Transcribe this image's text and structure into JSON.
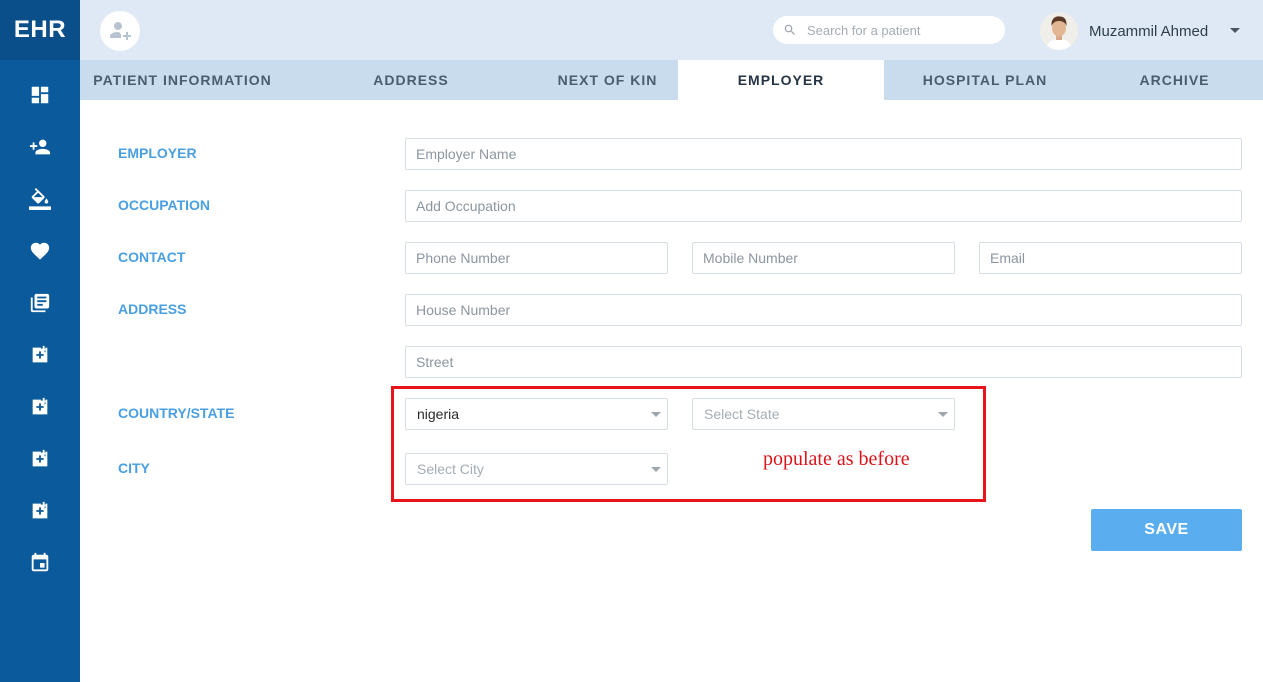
{
  "app": {
    "logo": "EHR"
  },
  "sidebar": {
    "icons": [
      "dashboard-icon",
      "add-user-icon",
      "paint-bucket-icon",
      "heart-icon",
      "library-books-icon",
      "local-hospital-icon",
      "local-hospital-icon",
      "local-hospital-icon",
      "local-hospital-icon",
      "calendar-icon"
    ]
  },
  "header": {
    "search_placeholder": "Search for a patient",
    "user_name": "Muzammil Ahmed"
  },
  "tabs": [
    {
      "label": "PATIENT INFORMATION"
    },
    {
      "label": "ADDRESS"
    },
    {
      "label": "NEXT OF KIN"
    },
    {
      "label": "EMPLOYER",
      "active": true
    },
    {
      "label": "HOSPITAL PLAN"
    },
    {
      "label": "ARCHIVE"
    }
  ],
  "form": {
    "labels": {
      "employer": "EMPLOYER",
      "occupation": "OCCUPATION",
      "contact": "CONTACT",
      "address": "ADDRESS",
      "country_state": "COUNTRY/STATE",
      "city": "CITY"
    },
    "placeholders": {
      "employer_name": "Employer Name",
      "occupation": "Add Occupation",
      "phone": "Phone Number",
      "mobile": "Mobile Number",
      "email": "Email",
      "house_number": "House Number",
      "street": "Street"
    },
    "country": {
      "value": "nigeria"
    },
    "state": {
      "placeholder": "Select State"
    },
    "city": {
      "placeholder": "Select City"
    },
    "save_label": "SAVE"
  },
  "annotation": {
    "text": "populate as before",
    "color": "#e8141a"
  },
  "colors": {
    "sidebar": "#0b5a9b",
    "label": "#4a9fe0",
    "save": "#5aaef0",
    "tabbar": "#c9dcee",
    "topbar": "#dfe9f5"
  }
}
